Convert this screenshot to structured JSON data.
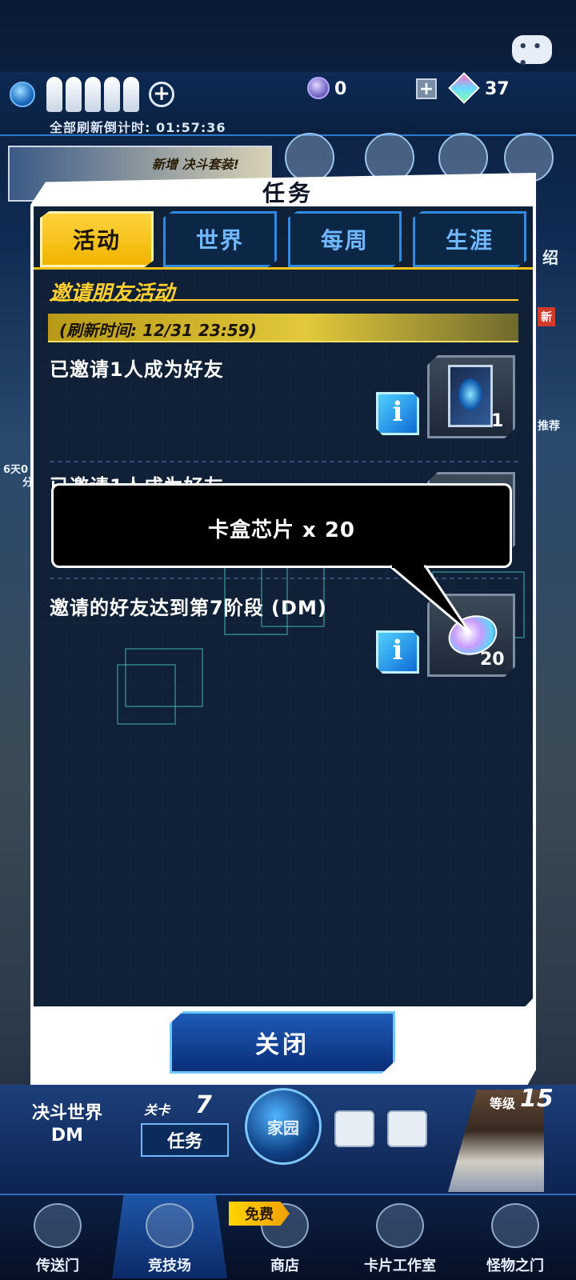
{
  "header": {
    "gem_count": "0",
    "crystal_count": "37",
    "refresh_countdown": "全部刷新倒计时: 01:57:36"
  },
  "background": {
    "banner_text": "新增 决斗套装!",
    "side_labels": [
      "绍",
      "新",
      "推荐",
      "6天0",
      "分"
    ]
  },
  "modal": {
    "title": "任务",
    "tabs": [
      {
        "label": "活动",
        "active": true
      },
      {
        "label": "世界",
        "active": false
      },
      {
        "label": "每周",
        "active": false
      },
      {
        "label": "生涯",
        "active": false
      }
    ],
    "section_title": "邀请朋友活动",
    "refresh_time": "(刷新时间: 12/31 23:59)",
    "tasks": [
      {
        "text": "已邀请1人成为好友",
        "reward_count": "1",
        "reward_icon": "card-box-icon"
      },
      {
        "text": "已邀请1人成为好友",
        "reward_count": "",
        "reward_icon": "card-box-icon"
      },
      {
        "text": "邀请的好友达到第7阶段 (DM)",
        "reward_count": "20",
        "reward_icon": "chip-icon"
      }
    ],
    "tooltip": "卡盒芯片 x 20",
    "close_label": "关闭"
  },
  "lobby": {
    "duel_world": "决斗世界",
    "duel_world_sub": "DM",
    "stage_label": "关卡",
    "stage_number": "7",
    "task_button": "任务",
    "home_label": "家园",
    "level_label": "等级",
    "level_number": "15"
  },
  "nav": {
    "items": [
      {
        "label": "传送门",
        "icon": "gate-icon"
      },
      {
        "label": "竞技场",
        "icon": "crossed-swords-icon",
        "active": true
      },
      {
        "label": "商店",
        "icon": "cart-icon",
        "badge": "免费"
      },
      {
        "label": "卡片工作室",
        "icon": "cards-icon"
      },
      {
        "label": "怪物之门",
        "icon": "lock-gate-icon"
      }
    ]
  },
  "colors": {
    "accent_yellow": "#ffcf2e",
    "panel_dark": "#102036",
    "tab_blue": "#2f8ae0",
    "close_button": "#1d5bb8"
  }
}
